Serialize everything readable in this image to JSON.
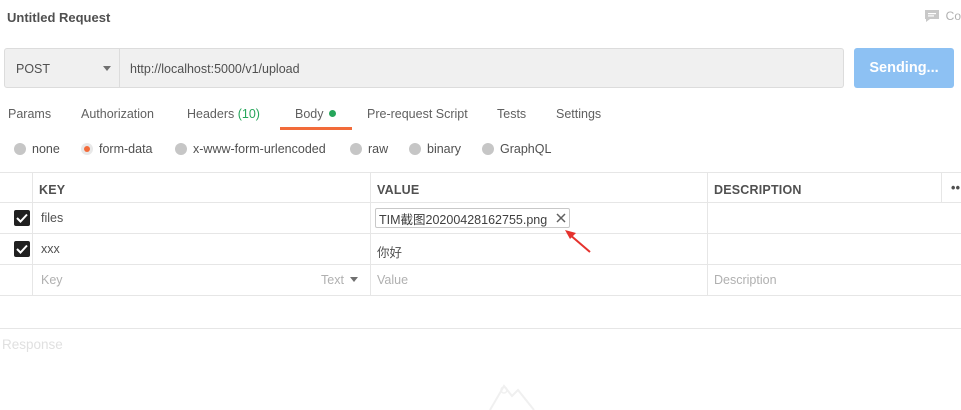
{
  "request": {
    "title": "Untitled Request"
  },
  "comments": {
    "label": "Co"
  },
  "url_bar": {
    "method": "POST",
    "url": "http://localhost:5000/v1/upload",
    "send_label": "Sending..."
  },
  "tabs": {
    "params": "Params",
    "authorization": "Authorization",
    "headers": "Headers",
    "headers_count": "(10)",
    "body": "Body",
    "prerequest": "Pre-request Script",
    "tests": "Tests",
    "settings": "Settings",
    "active": "Body"
  },
  "body_types": {
    "options": [
      "none",
      "form-data",
      "x-www-form-urlencoded",
      "raw",
      "binary",
      "GraphQL"
    ],
    "selected": "form-data"
  },
  "form_table": {
    "headers": {
      "key": "KEY",
      "value": "VALUE",
      "description": "DESCRIPTION",
      "more": "••"
    },
    "rows": [
      {
        "checked": true,
        "key": "files",
        "value_file": "TIM截图20200428162755.png",
        "description": ""
      },
      {
        "checked": true,
        "key": "xxx",
        "value": "你好",
        "description": ""
      }
    ],
    "new_row": {
      "key_placeholder": "Key",
      "type": "Text",
      "value_placeholder": "Value",
      "description_placeholder": "Description"
    }
  },
  "response": {
    "label": "Response"
  },
  "colors": {
    "accent": "#f26b3a",
    "send_button": "#8dc1f3",
    "green": "#26a65b"
  }
}
